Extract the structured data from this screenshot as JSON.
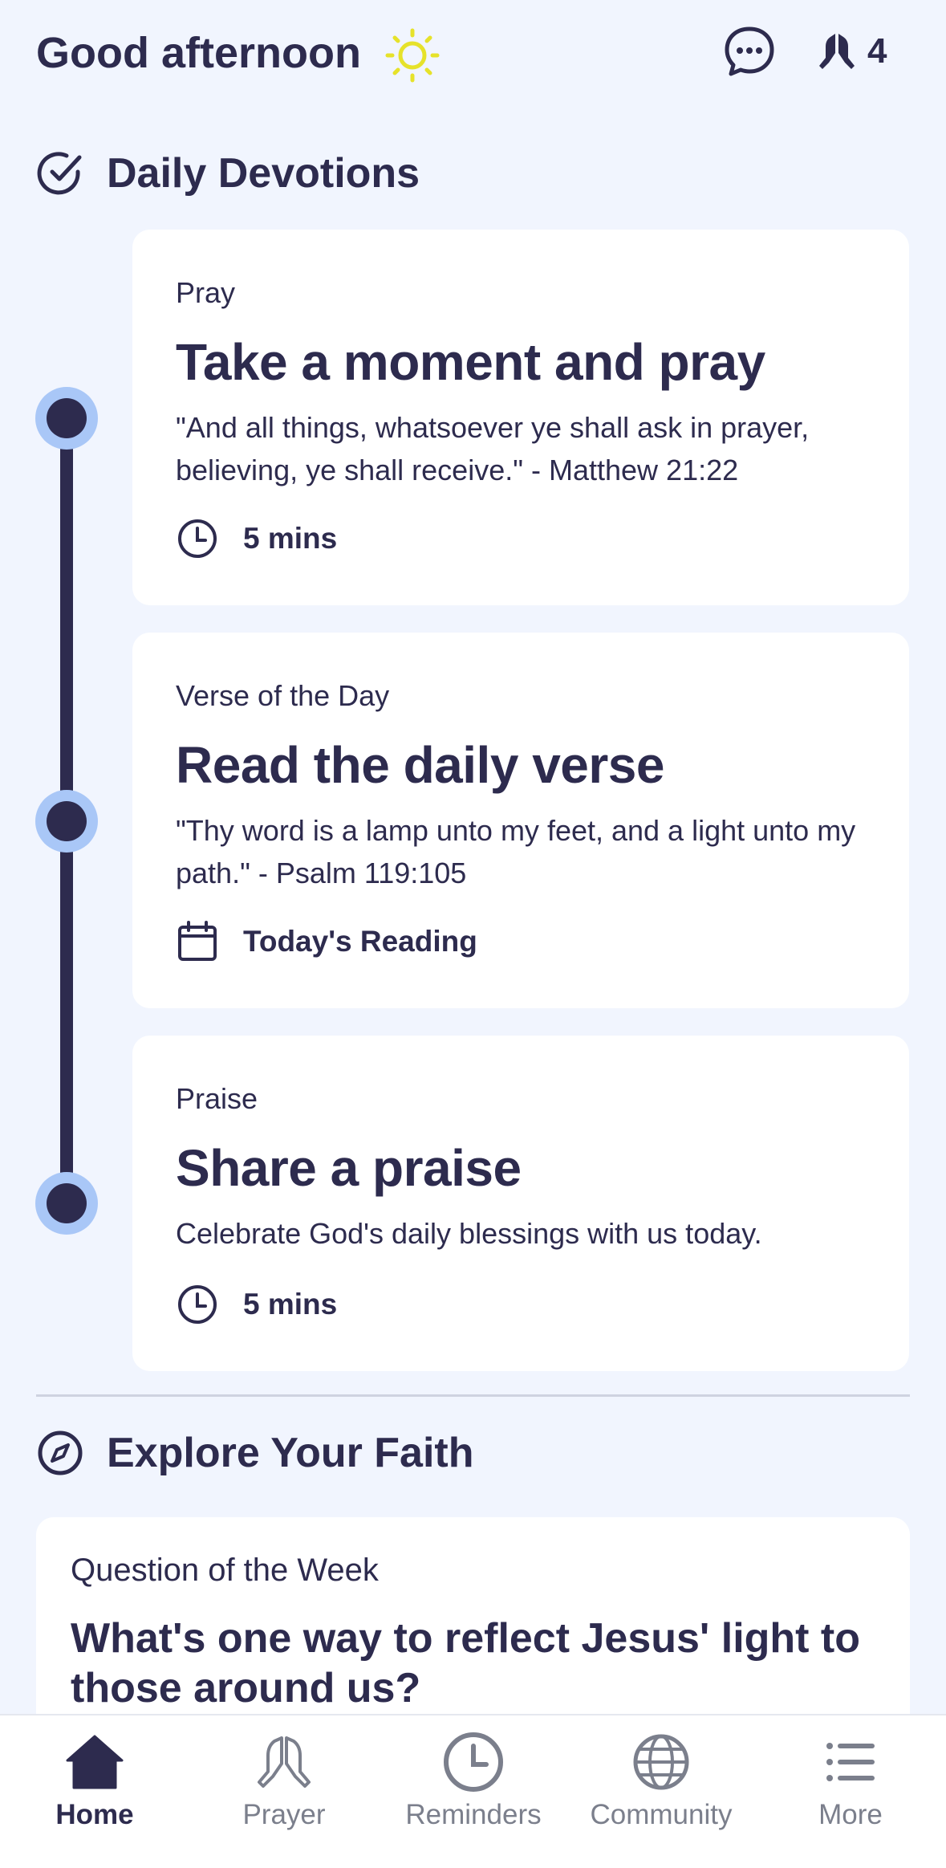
{
  "header": {
    "greeting": "Good afternoon",
    "sun_icon": "sun-icon",
    "chat_icon": "chat-bubble-icon",
    "prayer_count": "4"
  },
  "daily_devotions": {
    "title": "Daily Devotions",
    "cards": [
      {
        "eyebrow": "Pray",
        "title": "Take a moment and pray",
        "body": "\"And all things, whatsoever ye shall ask in prayer, believing, ye shall receive.\" - Matthew 21:22",
        "meta_icon": "clock-icon",
        "meta": "5 mins"
      },
      {
        "eyebrow": "Verse of the Day",
        "title": "Read the daily verse",
        "body": "\"Thy word is a lamp unto my feet, and a light unto my path.\" - Psalm 119:105",
        "meta_icon": "calendar-icon",
        "meta": "Today's Reading"
      },
      {
        "eyebrow": "Praise",
        "title": "Share a praise",
        "body": "Celebrate God's daily blessings with us today.",
        "meta_icon": "clock-icon",
        "meta": "5 mins"
      }
    ]
  },
  "explore": {
    "title": "Explore Your Faith",
    "question_card": {
      "eyebrow": "Question of the Week",
      "title": "What's one way to reflect Jesus' light to those around us?"
    }
  },
  "bottom_nav": {
    "items": [
      {
        "label": "Home",
        "icon": "home-icon",
        "active": true
      },
      {
        "label": "Prayer",
        "icon": "praying-hands-icon",
        "active": false
      },
      {
        "label": "Reminders",
        "icon": "clock-icon",
        "active": false
      },
      {
        "label": "Community",
        "icon": "globe-icon",
        "active": false
      },
      {
        "label": "More",
        "icon": "list-icon",
        "active": false
      }
    ]
  },
  "colors": {
    "background": "#f1f5fe",
    "text_primary": "#2d2b4e",
    "timeline_ring": "#a9c7f7",
    "sun": "#e6e22a",
    "nav_inactive": "#7b7f8c"
  }
}
